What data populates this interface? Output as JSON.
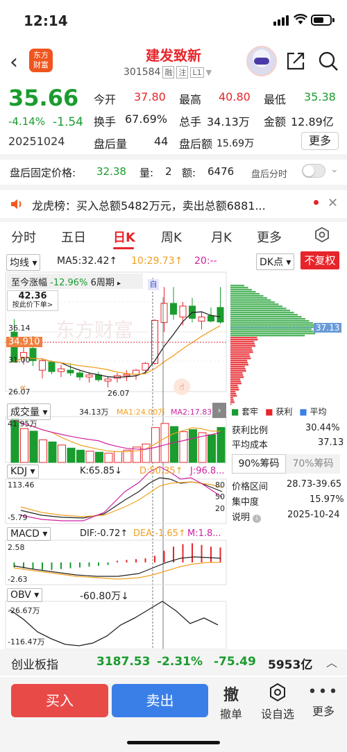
{
  "status": {
    "time": "12:14"
  },
  "header": {
    "logo_text": "东方财富",
    "name": "建发致新",
    "code": "301584",
    "tags": [
      "融",
      "注",
      "L1"
    ]
  },
  "quote": {
    "price": "35.66",
    "change_pct": "-4.14%",
    "change": "-1.54",
    "date": "20251024",
    "fields": [
      {
        "label": "今开",
        "value": "37.80",
        "color": "red"
      },
      {
        "label": "最高",
        "value": "40.80",
        "color": "red"
      },
      {
        "label": "最低",
        "value": "35.38",
        "color": "green"
      },
      {
        "label": "换手",
        "value": "67.69%",
        "color": "normal"
      },
      {
        "label": "总手",
        "value": "34.13万",
        "color": "normal"
      },
      {
        "label": "金额",
        "value": "12.89亿",
        "color": "normal"
      },
      {
        "label": "盘后量",
        "value": "44",
        "color": "normal"
      },
      {
        "label": "盘后额",
        "value": "15.69万",
        "color": "normal"
      }
    ],
    "more_label": "更多"
  },
  "after_hours": {
    "label": "盘后固定价格:",
    "price": "32.38",
    "qty_label": "量:",
    "qty": "2",
    "amt_label": "额:",
    "amt": "6476",
    "split_label": "盘后分时"
  },
  "lhb": {
    "text": "龙虎榜：买入总额5482万元，卖出总额6881..."
  },
  "tabs": [
    {
      "label": "分时"
    },
    {
      "label": "五日"
    },
    {
      "label": "日K"
    },
    {
      "label": "周K"
    },
    {
      "label": "月K"
    },
    {
      "label": "更多"
    }
  ],
  "toolbar": {
    "ma_select": "均线",
    "ma5": "MA5:32.42↑",
    "ma10": "10:29.73↑",
    "ma20": "20:--",
    "dk_select": "DK点",
    "fq_label": "不复权"
  },
  "kline": {
    "range_label": "至今涨幅",
    "range_pct": "-12.96%",
    "range_period": "6周期",
    "badge": "自",
    "tooltip_price": "42.36",
    "tooltip_hint": "按此价下单>",
    "y_high": "36.14",
    "y_mid": "31.00",
    "y_low": "26.07",
    "cur_price": "34.910",
    "low_mark": "26.07",
    "vol_select": "成交量",
    "vol_total": "34.13万",
    "vol_ma1": "MA1:24.00万",
    "vol_ma2": "MA2:17.83万",
    "vol_max": "41.95万",
    "kdj_select": "KDJ",
    "kdj_k": "K:65.85↓",
    "kdj_d": "D:50.35↑",
    "kdj_j": "J:96.8...",
    "kdj_max": "113.46",
    "kdj_min": "-5.79",
    "kdj_80": "80",
    "kdj_50": "50",
    "kdj_20": "20",
    "macd_select": "MACD",
    "macd_dif": "DIF:-0.72↑",
    "macd_dea": "DEA:-1.65↑",
    "macd_m": "M:1.8...",
    "macd_max": "2.58",
    "macd_min": "-2.63",
    "obv_select": "OBV",
    "obv_val": "-60.80万↓",
    "obv_max": "-26.67万",
    "obv_min": "-116.47万"
  },
  "chip": {
    "legend": [
      {
        "label": "套牢",
        "color": "#1a9c2e"
      },
      {
        "label": "获利",
        "color": "#e6252b"
      },
      {
        "label": "平均",
        "color": "#3a7fe8"
      }
    ],
    "avg_price": "37.13",
    "rows": [
      {
        "label": "获利比例",
        "value": "30.44%"
      },
      {
        "label": "平均成本",
        "value": "37.13"
      }
    ],
    "tab90": "90%筹码",
    "tab70": "70%筹码",
    "rows2": [
      {
        "label": "价格区间",
        "value": "28.73-39.65"
      },
      {
        "label": "集中度",
        "value": "15.97%"
      },
      {
        "label": "说明",
        "value": "2025-10-24"
      }
    ]
  },
  "index_bar": {
    "name": "创业板指",
    "value": "3187.53",
    "pct": "-2.31%",
    "change": "-75.49",
    "amount": "5953亿"
  },
  "bottom": {
    "buy": "买入",
    "sell": "卖出",
    "cancel": "撤单",
    "cancel_icon": "撤",
    "custom": "设自选",
    "more": "更多"
  },
  "chart_data": {
    "type": "candlestick",
    "dates": [],
    "ohlc": [
      [
        34.2,
        36.1,
        29.8,
        29.8
      ],
      [
        30.5,
        32.8,
        29.4,
        31.2
      ],
      [
        31.8,
        33.6,
        29.2,
        30.0
      ],
      [
        28.6,
        30.2,
        27.4,
        30.0
      ],
      [
        29.8,
        30.0,
        28.0,
        28.4
      ],
      [
        28.4,
        29.4,
        27.6,
        28.8
      ],
      [
        28.6,
        29.6,
        27.8,
        28.2
      ],
      [
        28.2,
        28.6,
        27.1,
        27.6
      ],
      [
        27.6,
        28.3,
        26.8,
        27.9
      ],
      [
        27.9,
        28.4,
        26.9,
        27.2
      ],
      [
        27.0,
        27.6,
        26.07,
        27.3
      ],
      [
        27.4,
        28.2,
        26.8,
        27.8
      ],
      [
        27.8,
        28.6,
        27.0,
        28.0
      ],
      [
        28.0,
        28.8,
        27.2,
        28.6
      ],
      [
        28.6,
        29.8,
        28.0,
        29.6
      ],
      [
        29.6,
        36.1,
        29.4,
        35.9
      ],
      [
        35.6,
        40.8,
        34.2,
        38.4
      ],
      [
        38.4,
        40.8,
        36.0,
        36.8
      ],
      [
        36.4,
        38.6,
        35.2,
        38.0
      ],
      [
        38.0,
        39.2,
        35.6,
        36.2
      ],
      [
        35.8,
        37.2,
        34.6,
        36.4
      ],
      [
        36.6,
        37.8,
        35.6,
        35.8
      ],
      [
        37.8,
        40.8,
        35.38,
        35.66
      ]
    ],
    "volume_wan": [
      41.95,
      33.0,
      30.5,
      22.0,
      20.0,
      17.0,
      14.0,
      12.0,
      11.0,
      10.0,
      9.0,
      10.5,
      12.0,
      15.0,
      18.0,
      34.0,
      38.0,
      35.0,
      30.0,
      32.0,
      29.0,
      27.0,
      34.13
    ],
    "ma5_last": 32.42,
    "ma10_last": 29.73,
    "ylim": [
      26.07,
      42.36
    ]
  }
}
